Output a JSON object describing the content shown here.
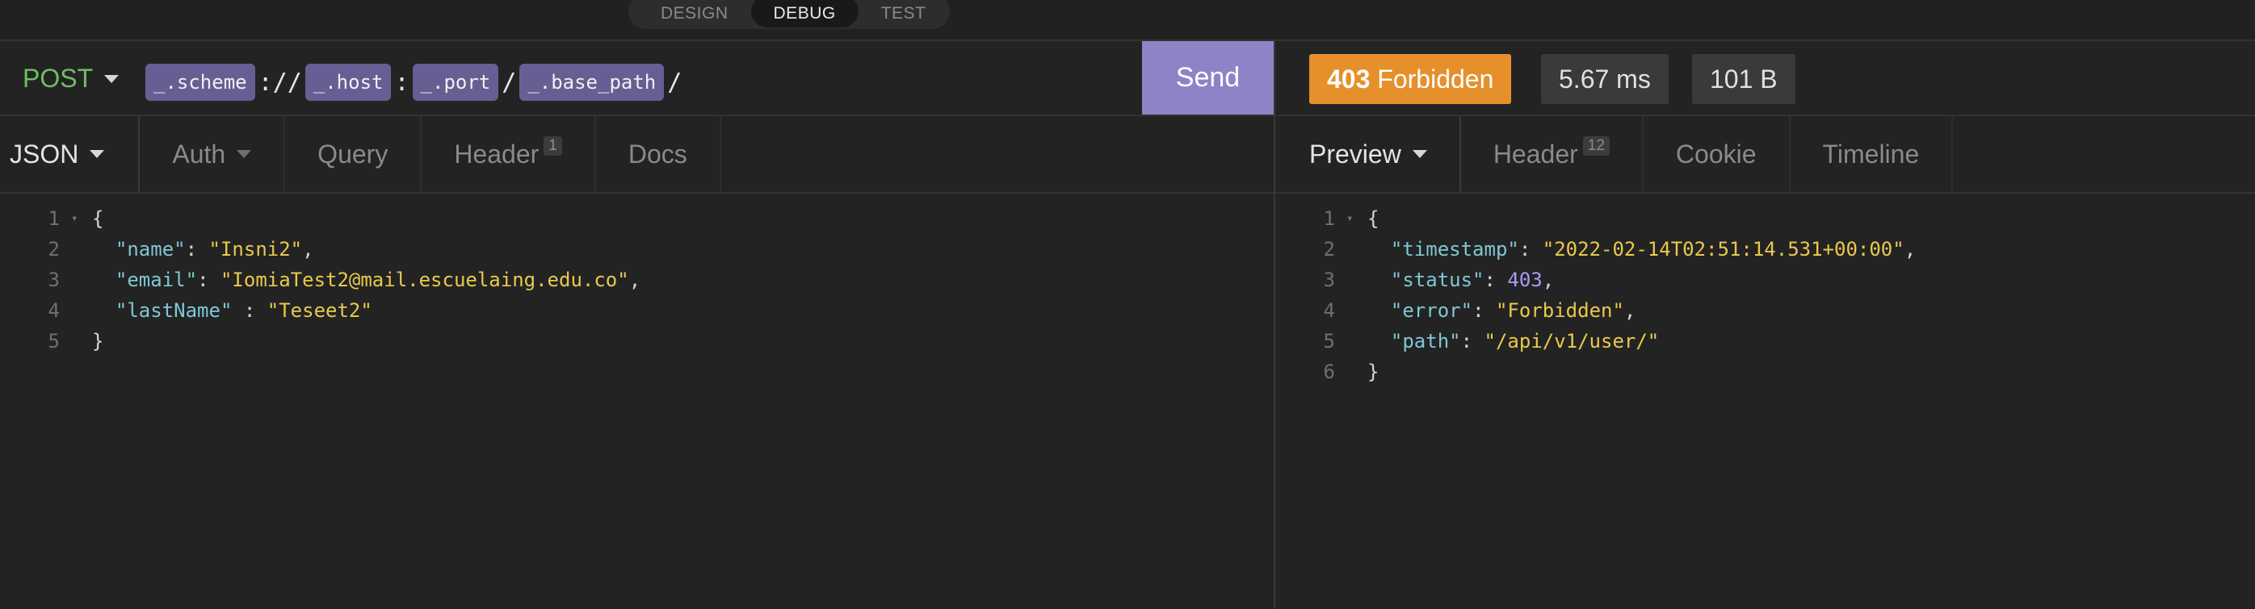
{
  "modes": [
    "DESIGN",
    "DEBUG",
    "TEST"
  ],
  "active_mode": "DEBUG",
  "request": {
    "method": "POST",
    "url_parts": [
      "_.scheme",
      "://",
      "_.host",
      ":",
      "_.port",
      "/",
      "_.base_path",
      "/"
    ],
    "send_label": "Send"
  },
  "request_tabs": [
    {
      "label": "JSON",
      "badge": ""
    },
    {
      "label": "Auth",
      "badge": ""
    },
    {
      "label": "Query",
      "badge": ""
    },
    {
      "label": "Header",
      "badge": "1"
    },
    {
      "label": "Docs",
      "badge": ""
    }
  ],
  "response": {
    "status_code": "403",
    "status_text": "Forbidden",
    "time": "5.67 ms",
    "size": "101 B"
  },
  "response_tabs": [
    {
      "label": "Preview",
      "badge": ""
    },
    {
      "label": "Header",
      "badge": "12"
    },
    {
      "label": "Cookie",
      "badge": ""
    },
    {
      "label": "Timeline",
      "badge": ""
    }
  ],
  "request_body": {
    "line_numbers": [
      "1",
      "2",
      "3",
      "4",
      "5"
    ],
    "brace_open": "{",
    "brace_close": "}",
    "fields": [
      {
        "key": "\"name\"",
        "sep": ": ",
        "value": "\"Insni2\"",
        "end": ","
      },
      {
        "key": "\"email\"",
        "sep": ": ",
        "value": "\"IomiaTest2@mail.escuelaing.edu.co\"",
        "end": ","
      },
      {
        "key": "\"lastName\"",
        "sep": " : ",
        "value": "\"Teseet2\"",
        "end": ""
      }
    ]
  },
  "response_body": {
    "line_numbers": [
      "1",
      "2",
      "3",
      "4",
      "5",
      "6"
    ],
    "brace_open": "{",
    "brace_close": "}",
    "fields": [
      {
        "key": "\"timestamp\"",
        "sep": ": ",
        "value": "\"2022-02-14T02:51:14.531+00:00\"",
        "end": ","
      },
      {
        "key": "\"status\"",
        "sep": ": ",
        "value": "403",
        "end": ","
      },
      {
        "key": "\"error\"",
        "sep": ": ",
        "value": "\"Forbidden\"",
        "end": ","
      },
      {
        "key": "\"path\"",
        "sep": ": ",
        "value": "\"/api/v1/user/\"",
        "end": ""
      }
    ]
  },
  "colors": {
    "method": "#6fbe65",
    "send": "#8d84c7",
    "status": "#e6902c",
    "tag": "#675f93",
    "json_key": "#7fc7d4",
    "json_string": "#e9c94b",
    "json_number": "#a99cf2"
  }
}
